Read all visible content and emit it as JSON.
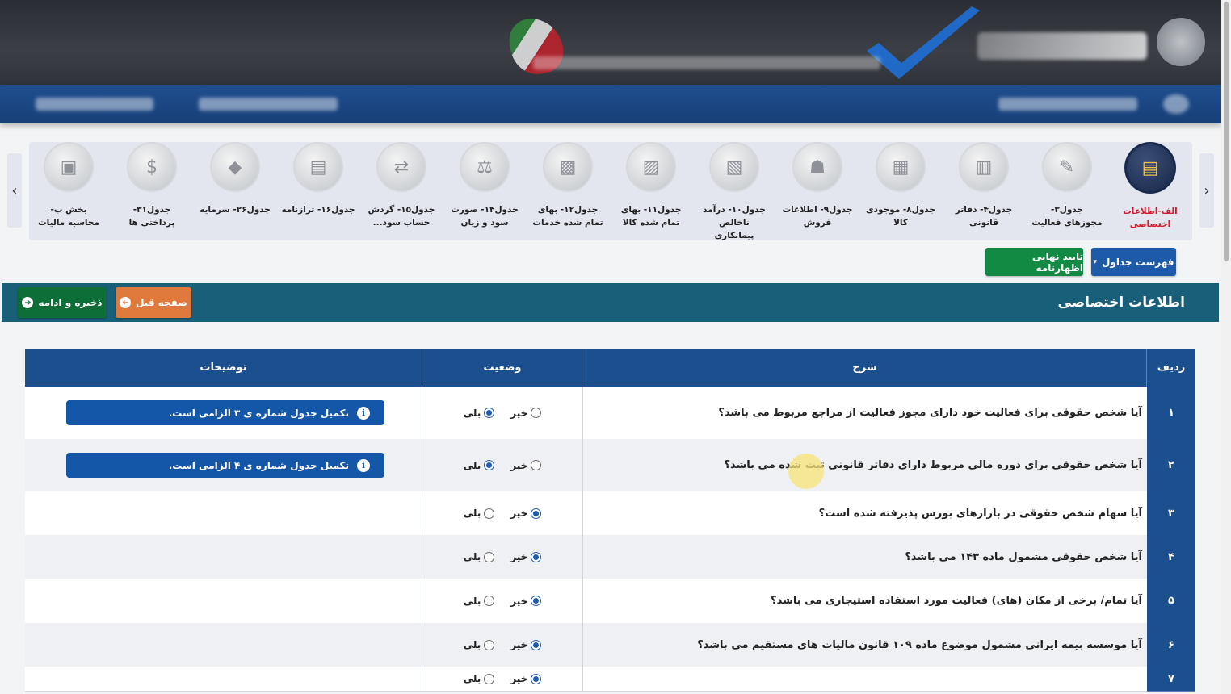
{
  "carousel": {
    "items": [
      {
        "label": "الف-اطلاعات\nاختصاصی",
        "active": true,
        "icon": "tax-docs-icon"
      },
      {
        "label": "جدول۳-\nمجوزهای فعالیت",
        "icon": "license-icon"
      },
      {
        "label": "جدول۴- دفاتر\nقانونی",
        "icon": "ledger-icon"
      },
      {
        "label": "جدول۸- موجودی\nکالا",
        "icon": "inventory-icon"
      },
      {
        "label": "جدول۹- اطلاعات\nفروش",
        "icon": "sales-icon"
      },
      {
        "label": "جدول۱۰- درآمد\nناخالص\nپیمانکاری",
        "icon": "contract-icon"
      },
      {
        "label": "جدول۱۱- بهای\nتمام شده کالا",
        "icon": "calculator-icon"
      },
      {
        "label": "جدول۱۲- بهای\nتمام شده خدمات",
        "icon": "building-icon"
      },
      {
        "label": "جدول۱۴- صورت\nسود و زیان",
        "icon": "balance-icon"
      },
      {
        "label": "جدول۱۵- گردش\nحساب سود...",
        "icon": "flow-icon"
      },
      {
        "label": "جدول۱۶- ترازنامه",
        "icon": "balance-sheet-icon"
      },
      {
        "label": "جدول۲۶- سرمایه",
        "icon": "money-bag-icon"
      },
      {
        "label": "جدول۳۱-\nپرداختی ها",
        "icon": "payment-icon"
      },
      {
        "label": "بخش ب-\nمحاسبه مالیات",
        "icon": "tax-icon"
      }
    ]
  },
  "toolbar": {
    "tables_menu": "فهرست جداول",
    "final_confirm": "تایید نهایی اظهارنامه",
    "save_continue": "ذخیره و ادامه",
    "prev_page": "صفحه قبل"
  },
  "section": {
    "title": "اطلاعات اختصاصی"
  },
  "table": {
    "headers": {
      "row": "ردیف",
      "desc": "شرح",
      "status": "وضعیت",
      "notes": "توضیحات"
    },
    "yes_label": "بلی",
    "no_label": "خیر",
    "rows": [
      {
        "num": "۱",
        "desc": "آیا شخص حقوقی برای فعالیت خود دارای مجوز فعالیت از مراجع مربوط می باشد؟",
        "answer": "yes",
        "note": "تکمیل جدول شماره ی ۳ الزامی است."
      },
      {
        "num": "۲",
        "desc": "آیا شخص حقوقی برای دوره مالی مربوط دارای دفاتر قانونی ثبت شده می باشد؟",
        "answer": "yes",
        "note": "تکمیل جدول شماره ی ۴ الزامی است."
      },
      {
        "num": "۳",
        "desc": "آیا سهام شخص حقوقی در بازارهای بورس پذیرفته شده است؟",
        "answer": "no",
        "note": ""
      },
      {
        "num": "۴",
        "desc": "آیا شخص حقوقی مشمول ماده ۱۴۳ می باشد؟",
        "answer": "no",
        "note": ""
      },
      {
        "num": "۵",
        "desc": "آیا تمام/ برخی از مکان (های) فعالیت مورد استفاده استیجاری می باشد؟",
        "answer": "no",
        "note": ""
      },
      {
        "num": "۶",
        "desc": "آیا موسسه بیمه ایرانی مشمول موضوع ماده ۱۰۹ قانون مالیات های مستقیم می باشد؟",
        "answer": "no",
        "note": ""
      },
      {
        "num": "۷",
        "desc": "",
        "answer": "no",
        "note": ""
      }
    ]
  }
}
